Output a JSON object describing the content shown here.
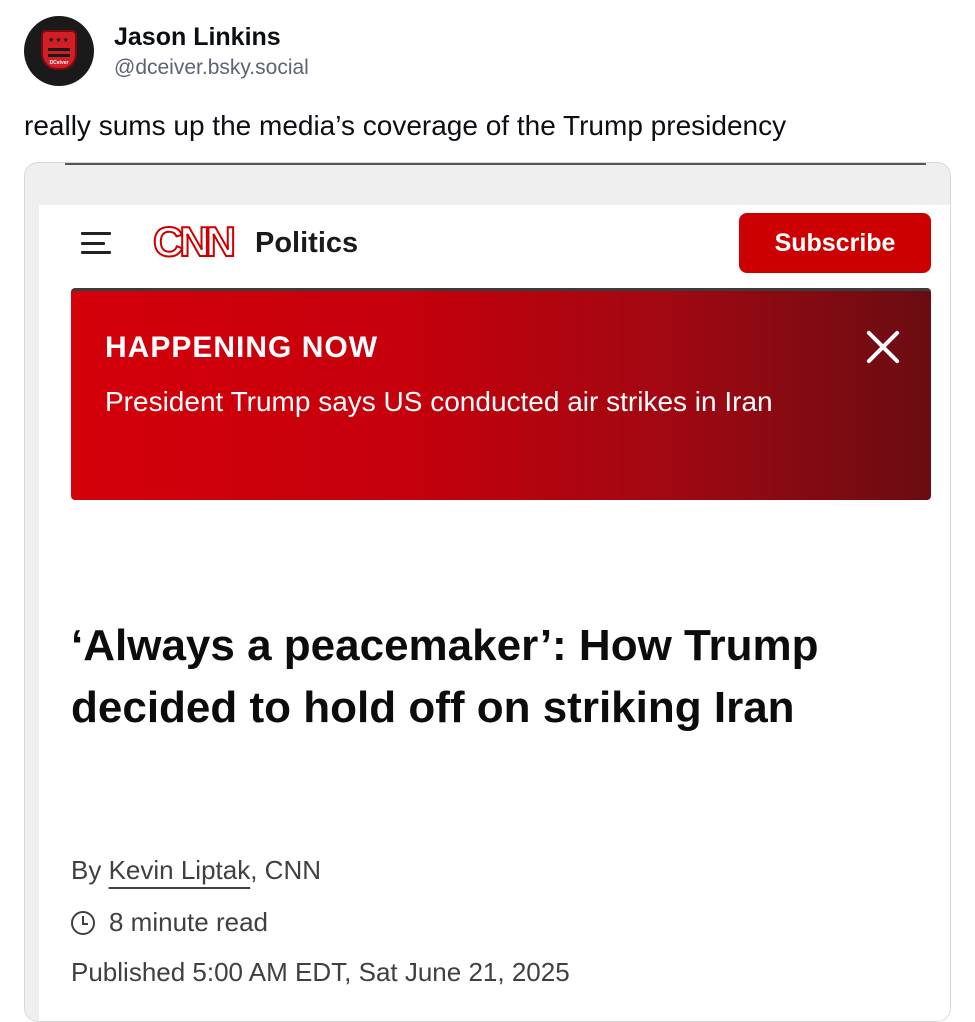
{
  "post": {
    "display_name": "Jason Linkins",
    "handle": "@dceiver.bsky.social",
    "text": "really sums up the media’s coverage of the Trump presidency",
    "avatar": {
      "icon": "shield-logo-icon",
      "stars": "★★★",
      "tag": "DCeiver"
    }
  },
  "embed": {
    "header": {
      "menu_icon": "hamburger-menu-icon",
      "logo": "CNN",
      "section": "Politics",
      "subscribe_label": "Subscribe"
    },
    "alert": {
      "label": "HAPPENING NOW",
      "text": "President Trump says US conducted air strikes in Iran",
      "close_icon": "close-icon",
      "color": "#cc0000"
    },
    "article": {
      "headline": "‘Always a peacemaker’: How Trump decided to hold off on striking Iran",
      "byline_prefix": "By ",
      "author": "Kevin Liptak",
      "byline_suffix": ", CNN",
      "read_time": "8 minute read",
      "published": "Published 5:00 AM EDT, Sat June 21, 2025"
    }
  },
  "colors": {
    "accent": "#cc0000",
    "handle": "#5b6572"
  }
}
